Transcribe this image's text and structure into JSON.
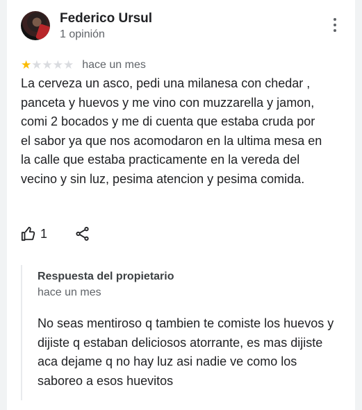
{
  "review": {
    "author_name": "Federico Ursul",
    "author_meta": "1 opinión",
    "rating": 1,
    "max_rating": 5,
    "star_glyph": "★",
    "time_ago": "hace un mes",
    "text": "La cerveza un asco, pedi una milanesa con chedar , panceta y huevos y me vino con muzzarella y jamon, comi 2 bocados y me di cuenta que estaba cruda por el sabor ya que nos acomodaron en la ultima mesa en la calle que estaba practicamente en la vereda del vecino y sin luz, pesima atencion y pesima comida.",
    "like_count": "1",
    "icons": {
      "avatar": "profile-photo",
      "more": "more-vert-icon",
      "like": "thumbs-up-icon",
      "share": "share-icon"
    }
  },
  "owner_reply": {
    "title": "Respuesta del propietario",
    "time_ago": "hace un mes",
    "text": "No seas mentiroso q tambien te comiste los huevos y dijiste q estaban deliciosos atorrante, es mas dijiste aca dejame q no hay luz asi nadie ve como los saboreo a esos huevitos"
  },
  "colors": {
    "star_filled": "#fbbc04",
    "star_empty": "#dadce0",
    "text_primary": "#202124",
    "text_secondary": "#5f6368",
    "page_background": "#f1f3f4"
  }
}
